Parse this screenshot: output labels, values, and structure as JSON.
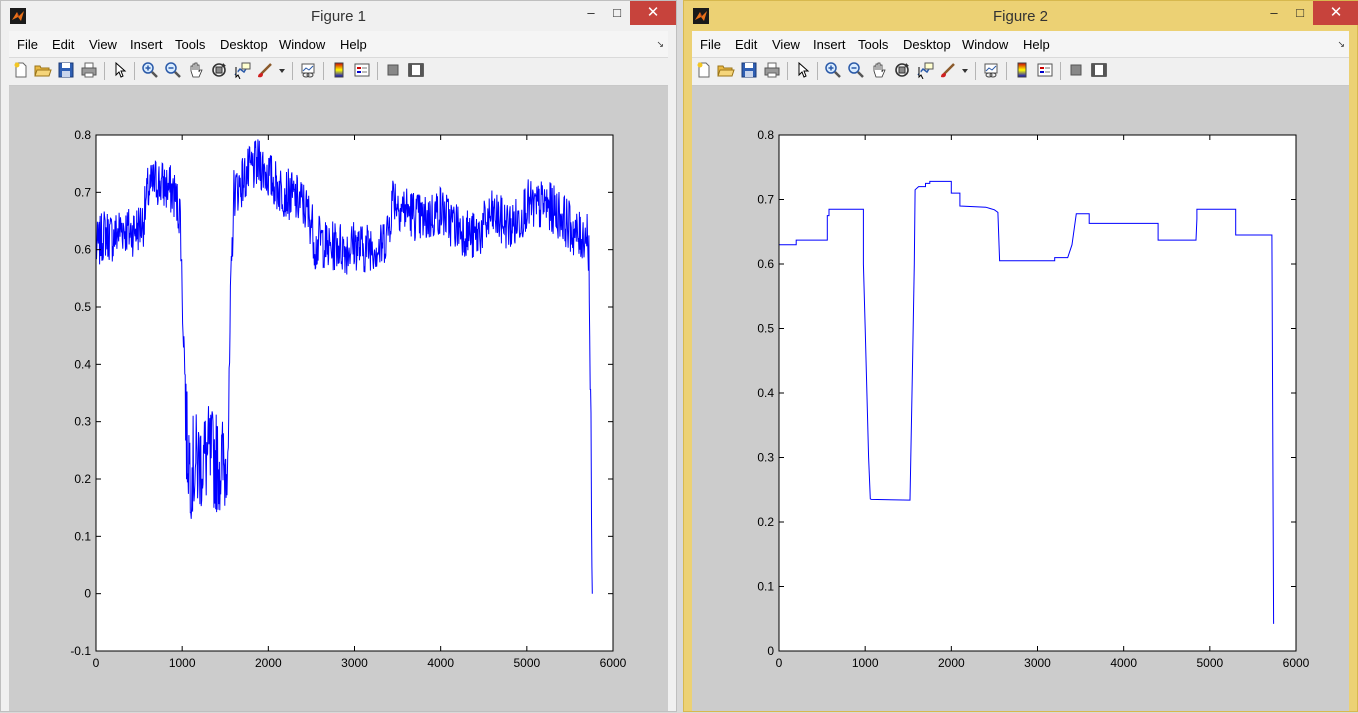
{
  "windows": [
    {
      "id": "figure1",
      "title": "Figure 1",
      "menu": [
        "File",
        "Edit",
        "View",
        "Insert",
        "Tools",
        "Desktop",
        "Window",
        "Help"
      ],
      "toolbar_icons": [
        "new-figure-icon",
        "open-file-icon",
        "save-icon",
        "print-icon",
        "edit-plot-icon",
        "zoom-in-icon",
        "zoom-out-icon",
        "pan-icon",
        "rotate-3d-icon",
        "data-cursor-icon",
        "brush-icon",
        "link-plot-icon",
        "colorbar-icon",
        "legend-icon",
        "hide-plot-tools-icon",
        "show-plot-tools-icon"
      ]
    },
    {
      "id": "figure2",
      "title": "Figure 2",
      "menu": [
        "File",
        "Edit",
        "View",
        "Insert",
        "Tools",
        "Desktop",
        "Window",
        "Help"
      ],
      "toolbar_icons": [
        "new-figure-icon",
        "open-file-icon",
        "save-icon",
        "print-icon",
        "edit-plot-icon",
        "zoom-in-icon",
        "zoom-out-icon",
        "pan-icon",
        "rotate-3d-icon",
        "data-cursor-icon",
        "brush-icon",
        "link-plot-icon",
        "colorbar-icon",
        "legend-icon",
        "hide-plot-tools-icon",
        "show-plot-tools-icon"
      ]
    }
  ],
  "colors": {
    "line": "#0000ff",
    "active_titlebar": "#ecd174",
    "inactive_titlebar": "#f0f0f0",
    "figure_background": "#cccccc",
    "close_button": "#c7433c"
  },
  "chart_data": [
    {
      "type": "line",
      "title": "",
      "xlabel": "",
      "ylabel": "",
      "xlim": [
        0,
        6000
      ],
      "ylim": [
        -0.1,
        0.8
      ],
      "xticks": [
        "0",
        "1000",
        "2000",
        "3000",
        "4000",
        "5000",
        "6000"
      ],
      "yticks": [
        "-0.1",
        "0",
        "0.1",
        "0.2",
        "0.3",
        "0.4",
        "0.5",
        "0.6",
        "0.7",
        "0.8"
      ],
      "grid": false,
      "noisy": true,
      "series": [
        {
          "color": "#0000ff",
          "x": [
            0,
            100,
            200,
            300,
            400,
            500,
            550,
            600,
            700,
            800,
            900,
            980,
            1000,
            1030,
            1050,
            1100,
            1200,
            1300,
            1400,
            1500,
            1540,
            1560,
            1600,
            1700,
            1800,
            1900,
            2000,
            2100,
            2200,
            2300,
            2400,
            2500,
            2550,
            2600,
            2700,
            2800,
            2900,
            3000,
            3100,
            3200,
            3300,
            3400,
            3450,
            3500,
            3600,
            3700,
            3800,
            3900,
            4000,
            4100,
            4200,
            4300,
            4400,
            4500,
            4600,
            4700,
            4800,
            4900,
            5000,
            5100,
            5200,
            5300,
            5400,
            5500,
            5600,
            5700,
            5720,
            5740,
            5760
          ],
          "values": [
            0.6,
            0.63,
            0.62,
            0.64,
            0.63,
            0.64,
            0.65,
            0.7,
            0.72,
            0.71,
            0.7,
            0.66,
            0.52,
            0.4,
            0.27,
            0.22,
            0.23,
            0.24,
            0.23,
            0.22,
            0.3,
            0.5,
            0.7,
            0.72,
            0.74,
            0.75,
            0.73,
            0.71,
            0.7,
            0.69,
            0.68,
            0.65,
            0.6,
            0.62,
            0.6,
            0.61,
            0.6,
            0.61,
            0.6,
            0.61,
            0.6,
            0.64,
            0.7,
            0.68,
            0.67,
            0.66,
            0.65,
            0.66,
            0.67,
            0.65,
            0.64,
            0.63,
            0.62,
            0.64,
            0.66,
            0.65,
            0.64,
            0.65,
            0.68,
            0.67,
            0.68,
            0.67,
            0.66,
            0.64,
            0.62,
            0.63,
            0.6,
            0.3,
            0.0
          ]
        }
      ]
    },
    {
      "type": "line",
      "title": "",
      "xlabel": "",
      "ylabel": "",
      "xlim": [
        0,
        6000
      ],
      "ylim": [
        0,
        0.8
      ],
      "xticks": [
        "0",
        "1000",
        "2000",
        "3000",
        "4000",
        "5000",
        "6000"
      ],
      "yticks": [
        "0",
        "0.1",
        "0.2",
        "0.3",
        "0.4",
        "0.5",
        "0.6",
        "0.7",
        "0.8"
      ],
      "grid": false,
      "noisy": false,
      "series": [
        {
          "color": "#0000ff",
          "x": [
            0,
            200,
            200,
            560,
            560,
            580,
            580,
            980,
            980,
            1000,
            1020,
            1040,
            1060,
            1070,
            1520,
            1530,
            1550,
            1570,
            1580,
            1620,
            1700,
            1700,
            1750,
            1750,
            2000,
            2000,
            2100,
            2100,
            2400,
            2450,
            2500,
            2540,
            2560,
            3200,
            3200,
            3350,
            3400,
            3450,
            3600,
            3600,
            4400,
            4400,
            4840,
            4850,
            4850,
            5300,
            5300,
            5720,
            5740
          ],
          "values": [
            0.63,
            0.63,
            0.637,
            0.637,
            0.675,
            0.675,
            0.685,
            0.685,
            0.6,
            0.5,
            0.4,
            0.3,
            0.236,
            0.235,
            0.234,
            0.3,
            0.45,
            0.6,
            0.715,
            0.72,
            0.72,
            0.725,
            0.725,
            0.728,
            0.728,
            0.71,
            0.71,
            0.69,
            0.688,
            0.686,
            0.684,
            0.68,
            0.605,
            0.605,
            0.61,
            0.61,
            0.63,
            0.678,
            0.678,
            0.663,
            0.663,
            0.637,
            0.637,
            0.67,
            0.685,
            0.685,
            0.645,
            0.645,
            0.042
          ]
        }
      ]
    }
  ]
}
